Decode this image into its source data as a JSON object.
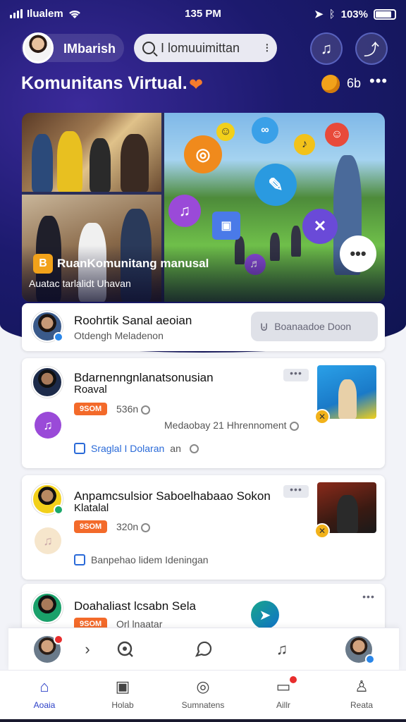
{
  "status_bar": {
    "carrier": "Ilualem",
    "time": "135 PM",
    "battery": "103%"
  },
  "header": {
    "username": "IMbarish",
    "search_value": "I lomuuimittan",
    "search_more": "⁝",
    "music_label": "♫",
    "share_label": "⤴"
  },
  "title_row": {
    "title": "Komunitans Virtual.",
    "coin_value": "6b",
    "more": "•••"
  },
  "banner": {
    "badge": "B",
    "title": "RuanKomunitang manusal",
    "subtitle": "Auatac tarlalidt Uhavan",
    "more": "•••",
    "bubbles": [
      "◎",
      "☺",
      "∞",
      "♪",
      "✎",
      "♫",
      "▣",
      "✕",
      "☺",
      "♬"
    ]
  },
  "profile_card": {
    "name": "Roohrtik Sanal aeoian",
    "subtitle": "Otdengh Meladenon",
    "follow_label": "Boanaadoe Doon"
  },
  "posts": [
    {
      "title": "Bdarnenngnlanatsonusian",
      "subtitle": "Roaval",
      "tag": "9SOM",
      "count": "536n",
      "context": "Medaobay 21 Hhrennoment",
      "link": "Sraglal I Dolaran",
      "link_suffix": "an"
    },
    {
      "title": "Anpamcsulsior Saboelhabaao Sokon",
      "subtitle": "Klatalal",
      "tag": "9SOM",
      "count": "320n",
      "link": "Banpehao lidem Ideningan"
    },
    {
      "title": "Doahaliast lcsabn Sela",
      "tag": "9SOM",
      "count": "Orl lnaatar"
    }
  ],
  "dock": {
    "arrow": "›"
  },
  "tabs": [
    {
      "label": "Aoaia",
      "icon": "home-icon"
    },
    {
      "label": "Holab",
      "icon": "inbox-icon"
    },
    {
      "label": "Sumnatens",
      "icon": "compass-icon"
    },
    {
      "label": "Aillr",
      "icon": "chat-icon"
    },
    {
      "label": "Reata",
      "icon": "profile-icon"
    }
  ],
  "colors": {
    "accent": "#2b3fc7",
    "hero": "#1c1a6e",
    "tag": "#f36a2a"
  }
}
